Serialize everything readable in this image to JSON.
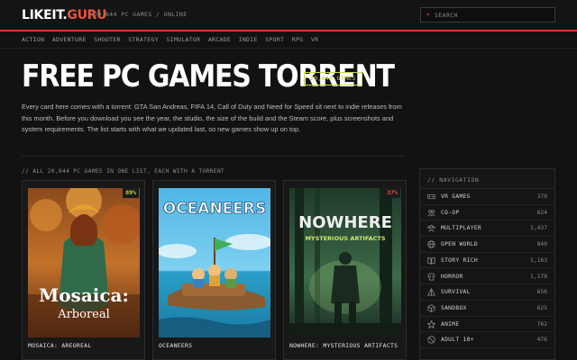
{
  "header": {
    "logo_main": "LIKEIT.",
    "logo_accent": "GURU",
    "tagline": "20,644 PC GAMES / ONLINE",
    "search_prompt": ">",
    "search_placeholder": "SEARCH"
  },
  "nav": [
    "ACTION",
    "ADVENTURE",
    "SHOOTER",
    "STRATEGY",
    "SIMULATOR",
    "ARCADE",
    "INDIE",
    "SPORT",
    "RPG",
    "VR"
  ],
  "hero": {
    "title": "FREE PC GAMES TORRENT",
    "badge": "20,644 GAMES",
    "intro": "Every card here comes with a torrent: GTA San Andreas, FIFA 14, Call of Duty and Need for Speed sit next to indie releases from this month. Before you download you see the year, the studio, the size of the build and the Steam score, plus screenshots and system requirements. The list starts with what we updated last, so new games show up on top."
  },
  "section_label": "// ALL 20,644 PC GAMES IN ONE LIST, EACH WITH A TORRENT",
  "games": [
    {
      "title": "MOSAICA: AREOREAL",
      "score": "89%",
      "score_color": "#c9d64a",
      "art_title_1": "Mosaica:",
      "art_title_2": "Arboreal"
    },
    {
      "title": "OCEANEERS",
      "score": "",
      "score_color": "",
      "art_title_1": "OCEANEERS",
      "art_title_2": ""
    },
    {
      "title": "NOWHERE: MYSTERIOUS ARTIFACTS",
      "score": "37%",
      "score_color": "#e8553a",
      "art_title_1": "NOWHERE",
      "art_title_2": "MYSTERIOUS ARTIFACTS"
    }
  ],
  "sidebar": {
    "heading": "// NAVIGATION",
    "items": [
      {
        "label": "VR GAMES",
        "count": "370",
        "icon": "vr-headset-icon"
      },
      {
        "label": "CO-OP",
        "count": "624",
        "icon": "users-icon"
      },
      {
        "label": "MULTIPLAYER",
        "count": "1,437",
        "icon": "group-icon"
      },
      {
        "label": "OPEN WORLD",
        "count": "840",
        "icon": "globe-icon"
      },
      {
        "label": "STORY RICH",
        "count": "1,163",
        "icon": "book-icon"
      },
      {
        "label": "HORROR",
        "count": "1,178",
        "icon": "skull-icon"
      },
      {
        "label": "SURVIVAL",
        "count": "656",
        "icon": "tent-icon"
      },
      {
        "label": "SANDBOX",
        "count": "625",
        "icon": "cube-icon"
      },
      {
        "label": "ANIME",
        "count": "762",
        "icon": "star-icon"
      },
      {
        "label": "ADULT 18+",
        "count": "476",
        "icon": "age-restricted-icon"
      }
    ]
  }
}
